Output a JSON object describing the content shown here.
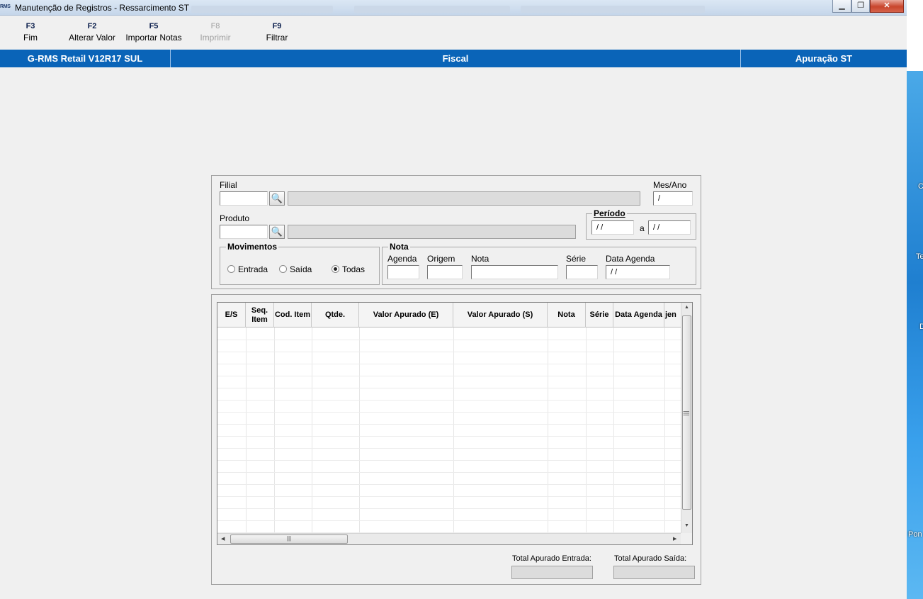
{
  "window": {
    "logo": "RMS",
    "title": "Manutenção de Registros - Ressarcimento ST",
    "controls": {
      "minimize": "▁",
      "maximize": "❐",
      "close": "✕"
    }
  },
  "toolbar": [
    {
      "key": "F3",
      "label": "Fim",
      "enabled": true
    },
    {
      "key": "F2",
      "label": "Alterar Valor",
      "enabled": true
    },
    {
      "key": "F5",
      "label": "Importar Notas",
      "enabled": true
    },
    {
      "key": "F8",
      "label": "Imprimir",
      "enabled": false
    },
    {
      "key": "F9",
      "label": "Filtrar",
      "enabled": true
    }
  ],
  "statusbar": {
    "system": "G-RMS Retail V12R17 SUL",
    "module": "Fiscal",
    "screen": "Apuração ST"
  },
  "filter": {
    "filial_label": "Filial",
    "filial_value": "",
    "mes_ano_label": "Mes/Ano",
    "mes_ano_value": "/",
    "produto_label": "Produto",
    "produto_value": "",
    "periodo_title": "Período",
    "periodo_from": "/ /",
    "periodo_sep": "a",
    "periodo_to": "/ /",
    "movimentos_title": "Movimentos",
    "movimentos_options": [
      "Entrada",
      "Saída",
      "Todas"
    ],
    "movimentos_selected": "Todas",
    "nota_title": "Nota",
    "agenda_label": "Agenda",
    "agenda_value": "",
    "origem_label": "Origem",
    "origem_value": "",
    "nota_label": "Nota",
    "nota_value": "",
    "serie_label": "Série",
    "serie_value": "",
    "data_agenda_label": "Data Agenda",
    "data_agenda_value": "/ /"
  },
  "grid": {
    "columns": [
      "E/S",
      "Seq. Item",
      "Cod. Item",
      "Qtde.",
      "Valor Apurado (E)",
      "Valor Apurado (S)",
      "Nota",
      "Série",
      "Data Agenda",
      "jen"
    ],
    "rows": [],
    "scroll_glyph": "|||"
  },
  "totals": {
    "entrada_label": "Total Apurado Entrada:",
    "entrada_value": "",
    "saida_label": "Total Apurado Saída:",
    "saida_value": ""
  },
  "desktop_fragments": [
    "C",
    "Te",
    "D",
    "Pon"
  ],
  "colors": {
    "statusbar": "#0a64b8",
    "background": "#f0f0f0"
  }
}
